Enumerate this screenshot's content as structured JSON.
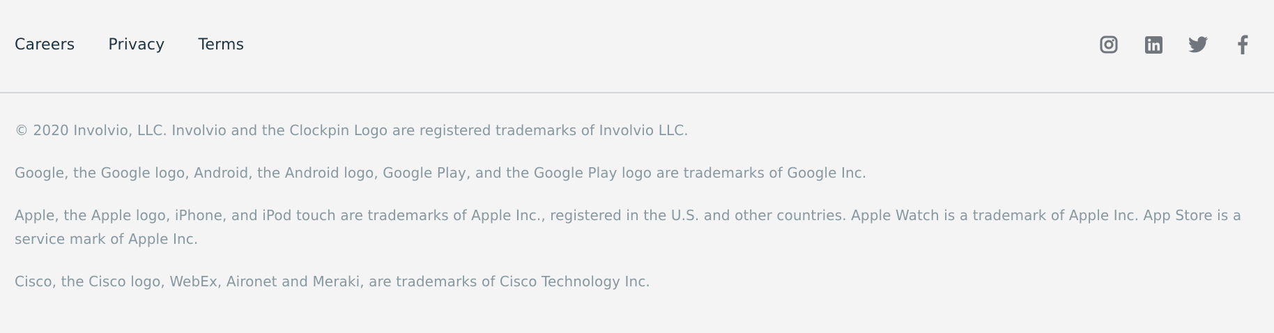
{
  "nav": {
    "links": [
      {
        "label": "Careers"
      },
      {
        "label": "Privacy"
      },
      {
        "label": "Terms"
      }
    ]
  },
  "social": {
    "icons": [
      "instagram-icon",
      "linkedin-icon",
      "twitter-icon",
      "facebook-icon"
    ],
    "icon_color": "#70767c"
  },
  "legal": {
    "copyright": "© 2020 Involvio, LLC. Involvio and the Clockpin Logo are registered trademarks of Involvio LLC.",
    "google": "Google, the Google logo, Android, the Android logo, Google Play, and the Google Play logo are trademarks of Google Inc.",
    "apple": "Apple, the Apple logo, iPhone, and iPod touch are trademarks of Apple Inc., registered in the U.S. and other countries. Apple Watch is a trademark of Apple Inc. App Store is a service mark of Apple Inc.",
    "cisco": "Cisco, the Cisco logo, WebEx, Aironet and Meraki, are trademarks of Cisco Technology Inc."
  },
  "colors": {
    "background": "#f4f4f4",
    "nav_text": "#1f3440",
    "legal_text": "#8798a0",
    "divider": "#d4d8da"
  }
}
